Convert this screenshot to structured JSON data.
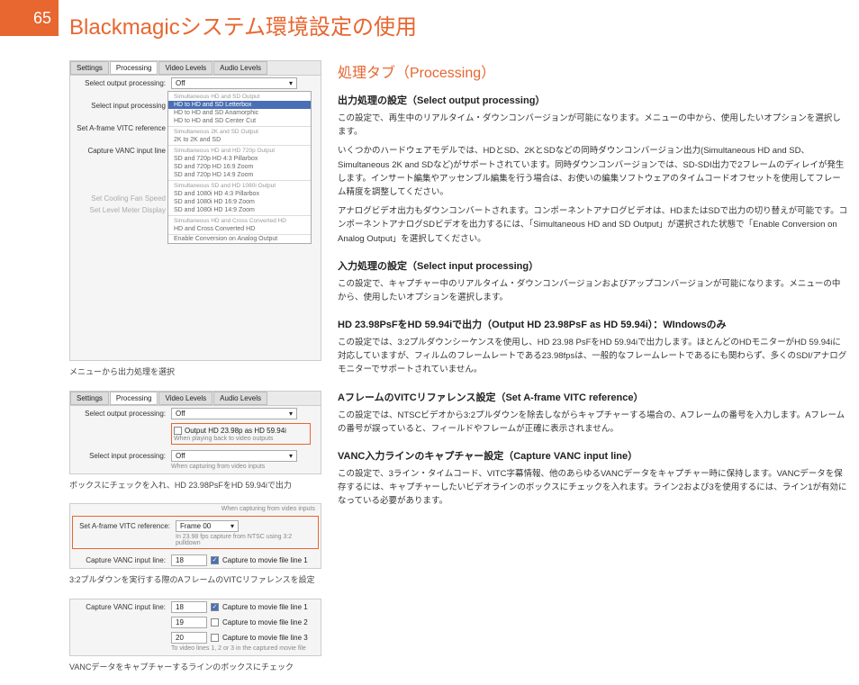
{
  "page_number": "65",
  "title": "Blackmagicシステム環境設定の使用",
  "right": {
    "section_title": "処理タブ（Processing）",
    "s1_head": "出力処理の設定（Select output processing）",
    "s1_p1": "この設定で、再生中のリアルタイム・ダウンコンバージョンが可能になります。メニューの中から、使用したいオプションを選択します。",
    "s1_p2": "いくつかのハードウェアモデルでは、HDとSD、2KとSDなどの同時ダウンコンバージョン出力(Simultaneous HD and SD、Simultaneous 2K and SDなど)がサポートされています。同時ダウンコンバージョンでは、SD-SDI出力で2フレームのディレイが発生します。インサート編集やアッセンブル編集を行う場合は、お使いの編集ソフトウェアのタイムコードオフセットを使用してフレーム精度を調整してください。",
    "s1_p3": "アナログビデオ出力もダウンコンバートされます。コンポーネントアナログビデオは、HDまたはSDで出力の切り替えが可能です。コンポーネントアナログSDビデオを出力するには、「Simultaneous HD and SD Output」が選択された状態で「Enable Conversion on Analog Output」を選択してください。",
    "s2_head": "入力処理の設定（Select input processing）",
    "s2_p1": "この設定で、キャプチャー中のリアルタイム・ダウンコンバージョンおよびアップコンバージョンが可能になります。メニューの中から、使用したいオプションを選択します。",
    "s3_head": "HD 23.98PsFをHD 59.94iで出力（Output HD 23.98PsF as HD 59.94i）：WIndowsのみ",
    "s3_p1": "この設定では、3:2プルダウンシーケンスを使用し、HD 23.98 PsFをHD 59.94iで出力します。ほとんどのHDモニターがHD 59.94iに対応していますが、フィルムのフレームレートである23.98fpsは、一般的なフレームレートであるにも関わらず、多くのSDI/アナログモニターでサポートされていません。",
    "s4_head": "AフレームのVITCリファレンス設定（Set A-frame VITC reference）",
    "s4_p1": "この設定では、NTSCビデオから3:2プルダウンを除去しながらキャプチャーする場合の、Aフレームの番号を入力します。Aフレームの番号が誤っていると、フィールドやフレームが正確に表示されません。",
    "s5_head": "VANC入力ラインのキャプチャー設定（Capture VANC input line）",
    "s5_p1": "この設定で、3ライン・タイムコード、VITC字幕情報、他のあらゆるVANCデータをキャプチャー時に保持します。VANCデータを保存するには、キャプチャーしたいビデオラインのボックスにチェックを入れます。ライン2および3を使用するには、ライン1が有効になっている必要があります。"
  },
  "left": {
    "tabs": {
      "t1": "Settings",
      "t2": "Processing",
      "t3": "Video Levels",
      "t4": "Audio Levels"
    },
    "ss1": {
      "r1_label": "Select output processing:",
      "r1_val": "Off",
      "r2_label": "Select input processing",
      "r3_label": "Set A-frame VITC reference",
      "r4_label": "Capture VANC input line",
      "r5_label": "Set Cooling Fan Speed",
      "r6_label": "Set Level Meter Display",
      "menu": {
        "g1_h": "Simultaneous HD and SD Output",
        "g1_1": "HD to HD and SD Letterbox",
        "g1_2": "HD to HD and SD Anamorphic",
        "g1_3": "HD to HD and SD Center Cut",
        "g2_h": "Simultaneous 2K and SD Output",
        "g2_1": "2K to 2K and SD",
        "g3_h": "Simultaneous HD and HD 720p Output",
        "g3_1": "SD and 720p HD 4:3 Pillarbox",
        "g3_2": "SD and 720p HD 16:9 Zoom",
        "g3_3": "SD and 720p HD 14:9 Zoom",
        "g4_h": "Simultaneous SD and HD 1080i Output",
        "g4_1": "SD and 1080i HD 4:3 Pillarbox",
        "g4_2": "SD and 1080i HD 16:9 Zoom",
        "g4_3": "SD and 1080i HD 14:9 Zoom",
        "g5_h": "Simultaneous HD and Cross Converted HD",
        "g5_1": "HD and Cross Converted HD",
        "g6_1": "Enable Conversion on Analog Output"
      },
      "caption": "メニューから出力処理を選択"
    },
    "ss2": {
      "r1_label": "Select output processing:",
      "r1_val": "Off",
      "chk1": "Output HD 23.98p as HD 59.94i",
      "chk1_sub": "When playing back to video outputs",
      "r2_label": "Select input processing:",
      "r2_val": "Off",
      "r2_sub": "When capturing from video inputs",
      "caption": "ボックスにチェックを入れ、HD 23.98PsFをHD 59.94iで出力"
    },
    "ss3": {
      "r1_label": "Set A-frame VITC reference:",
      "r1_val": "Frame 00",
      "r1_sub": "In 23.98 fps capture from NTSC using 3:2 pulldown",
      "foot_sub": "When capturing from video inputs",
      "r2_label": "Capture VANC input line:",
      "r2_val": "18",
      "r2_chk": "Capture to movie file line 1",
      "caption": "3:2プルダウンを実行する際のAフレームのVITCリファレンスを設定"
    },
    "ss4": {
      "r1_label": "Capture VANC input line:",
      "v1": "18",
      "c1": "Capture to movie file line 1",
      "v2": "19",
      "c2": "Capture to movie file line 2",
      "v3": "20",
      "c3": "Capture to movie file line 3",
      "sub": "To video lines 1, 2 or 3 in the captured movie file",
      "caption": "VANCデータをキャプチャーするラインのボックスにチェック"
    }
  }
}
